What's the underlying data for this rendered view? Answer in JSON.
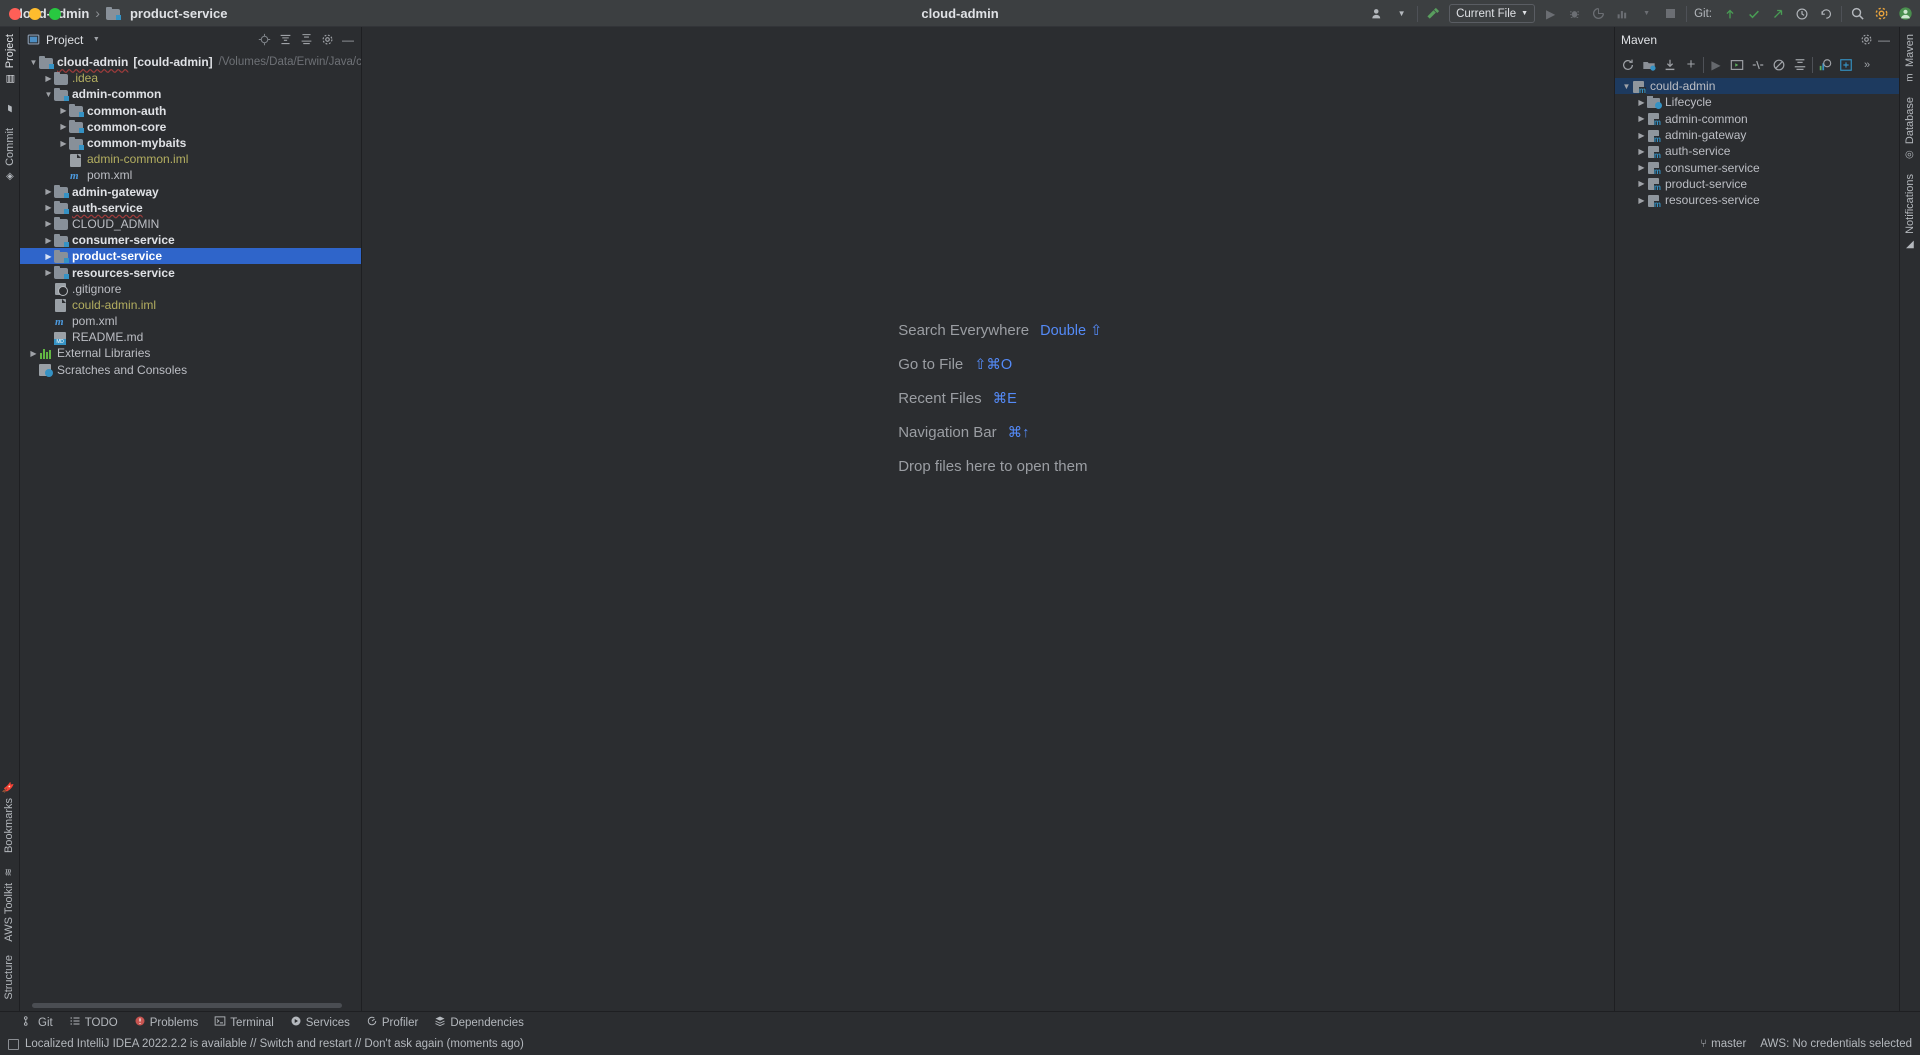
{
  "titlebar": {
    "breadcrumb_project": "cloud-admin",
    "breadcrumb_sep": "›",
    "breadcrumb_module": "product-service",
    "window_title": "cloud-admin",
    "run_config": "Current File",
    "git_label": "Git:",
    "icons": {
      "account": "account-icon",
      "dropdown": "chevron-down-icon",
      "build": "build-hammer-icon",
      "run": "run-icon",
      "debug": "debug-icon",
      "coverage": "coverage-icon",
      "profiler": "profiler-icon",
      "more": "more-icon",
      "stop": "stop-icon",
      "update": "git-update-icon",
      "commit": "git-commit-icon",
      "push": "git-push-icon",
      "history": "history-icon",
      "rollback": "rollback-icon",
      "search": "search-icon",
      "settings": "settings-gear-icon",
      "avatar": "user-avatar-icon"
    }
  },
  "left_rail": {
    "top_tabs": [
      {
        "label": "Project",
        "icon": "project-icon",
        "active": true
      },
      {
        "label": "",
        "icon": "folder-icon",
        "active": false
      },
      {
        "label": "Commit",
        "icon": "commit-icon",
        "active": false
      }
    ],
    "bottom_tabs": [
      {
        "label": "Bookmarks",
        "icon": "bookmark-icon"
      },
      {
        "label": "AWS Toolkit",
        "icon": "aws-icon"
      },
      {
        "label": "Structure",
        "icon": "structure-icon"
      }
    ]
  },
  "project_panel": {
    "title": "Project",
    "toolbar_icons": [
      "target-locate-icon",
      "expand-all-icon",
      "collapse-all-icon",
      "settings-gear-icon",
      "hide-icon"
    ],
    "tree": [
      {
        "label": "cloud-admin",
        "bracket": "[could-admin]",
        "path": "/Volumes/Data/Erwin/Java/cloud-",
        "indent": 0,
        "arrow": "down",
        "icon": "module-folder",
        "bold": true,
        "squiggle": true
      },
      {
        "label": ".idea",
        "indent": 1,
        "arrow": "right",
        "icon": "folder",
        "color": "yellow"
      },
      {
        "label": "admin-common",
        "indent": 1,
        "arrow": "down",
        "icon": "module-folder",
        "bold": true
      },
      {
        "label": "common-auth",
        "indent": 2,
        "arrow": "right",
        "icon": "module-folder",
        "bold": true
      },
      {
        "label": "common-core",
        "indent": 2,
        "arrow": "right",
        "icon": "module-folder",
        "bold": true
      },
      {
        "label": "common-mybaits",
        "indent": 2,
        "arrow": "right",
        "icon": "module-folder",
        "bold": true
      },
      {
        "label": "admin-common.iml",
        "indent": 2,
        "arrow": "none",
        "icon": "iml-file",
        "color": "yellow"
      },
      {
        "label": "pom.xml",
        "indent": 2,
        "arrow": "none",
        "icon": "maven-pom"
      },
      {
        "label": "admin-gateway",
        "indent": 1,
        "arrow": "right",
        "icon": "module-folder",
        "bold": true
      },
      {
        "label": "auth-service",
        "indent": 1,
        "arrow": "right",
        "icon": "module-folder",
        "bold": true,
        "squiggle": true
      },
      {
        "label": "CLOUD_ADMIN",
        "indent": 1,
        "arrow": "right",
        "icon": "folder"
      },
      {
        "label": "consumer-service",
        "indent": 1,
        "arrow": "right",
        "icon": "module-folder",
        "bold": true
      },
      {
        "label": "product-service",
        "indent": 1,
        "arrow": "right",
        "icon": "module-folder",
        "bold": true,
        "selected": true
      },
      {
        "label": "resources-service",
        "indent": 1,
        "arrow": "right",
        "icon": "module-folder",
        "bold": true
      },
      {
        "label": ".gitignore",
        "indent": 1,
        "arrow": "none",
        "icon": "gitignore-file"
      },
      {
        "label": "could-admin.iml",
        "indent": 1,
        "arrow": "none",
        "icon": "iml-file",
        "color": "yellow"
      },
      {
        "label": "pom.xml",
        "indent": 1,
        "arrow": "none",
        "icon": "maven-pom"
      },
      {
        "label": "README.md",
        "indent": 1,
        "arrow": "none",
        "icon": "markdown-file"
      },
      {
        "label": "External Libraries",
        "indent": 0,
        "arrow": "right",
        "icon": "library-icon"
      },
      {
        "label": "Scratches and Consoles",
        "indent": 0,
        "arrow": "none",
        "icon": "scratch-icon"
      }
    ]
  },
  "editor": {
    "hints": [
      {
        "label": "Search Everywhere",
        "key": "Double ⇧"
      },
      {
        "label": "Go to File",
        "key": "⇧⌘O"
      },
      {
        "label": "Recent Files",
        "key": "⌘E"
      },
      {
        "label": "Navigation Bar",
        "key": "⌘↑"
      }
    ],
    "drop_text": "Drop files here to open them"
  },
  "maven_panel": {
    "title": "Maven",
    "toolbar_icons": [
      "reload-icon",
      "add-maven-project-icon",
      "download-sources-icon",
      "add-icon",
      "run-icon",
      "execute-goal-icon",
      "skip-tests-icon",
      "toggle-offline-icon",
      "collapse-all-icon",
      "show-dependencies-icon",
      "expand-icon",
      "more-icon"
    ],
    "header_icons": [
      "settings-gear-icon",
      "hide-icon"
    ],
    "tree": [
      {
        "label": "could-admin",
        "indent": 0,
        "arrow": "down",
        "icon": "maven-project",
        "selected": true
      },
      {
        "label": "Lifecycle",
        "indent": 1,
        "arrow": "right",
        "icon": "lifecycle-folder"
      },
      {
        "label": "admin-common",
        "indent": 1,
        "arrow": "right",
        "icon": "maven-project"
      },
      {
        "label": "admin-gateway",
        "indent": 1,
        "arrow": "right",
        "icon": "maven-project"
      },
      {
        "label": "auth-service",
        "indent": 1,
        "arrow": "right",
        "icon": "maven-project"
      },
      {
        "label": "consumer-service",
        "indent": 1,
        "arrow": "right",
        "icon": "maven-project"
      },
      {
        "label": "product-service",
        "indent": 1,
        "arrow": "right",
        "icon": "maven-project"
      },
      {
        "label": "resources-service",
        "indent": 1,
        "arrow": "right",
        "icon": "maven-project"
      }
    ]
  },
  "right_rail": {
    "tabs": [
      {
        "label": "Maven",
        "icon": "maven-icon"
      },
      {
        "label": "Database",
        "icon": "database-icon"
      },
      {
        "label": "Notifications",
        "icon": "notifications-icon"
      }
    ]
  },
  "bottom_toolwindows": [
    {
      "label": "Git",
      "icon": "git-branch-icon"
    },
    {
      "label": "TODO",
      "icon": "todo-icon"
    },
    {
      "label": "Problems",
      "icon": "problems-icon"
    },
    {
      "label": "Terminal",
      "icon": "terminal-icon"
    },
    {
      "label": "Services",
      "icon": "services-icon"
    },
    {
      "label": "Profiler",
      "icon": "profiler-icon"
    },
    {
      "label": "Dependencies",
      "icon": "dependencies-icon"
    }
  ],
  "status_bar": {
    "message": "Localized IntelliJ IDEA 2022.2.2 is available // Switch and restart // Don't ask again (moments ago)",
    "branch": "master",
    "aws": "AWS: No credentials selected"
  },
  "colors": {
    "selection_blue": "#2f65ca",
    "maven_selection": "#1d3a5f",
    "link_blue": "#548af7",
    "panel_bg": "#2b2d30",
    "titlebar_bg": "#3c3f41"
  }
}
